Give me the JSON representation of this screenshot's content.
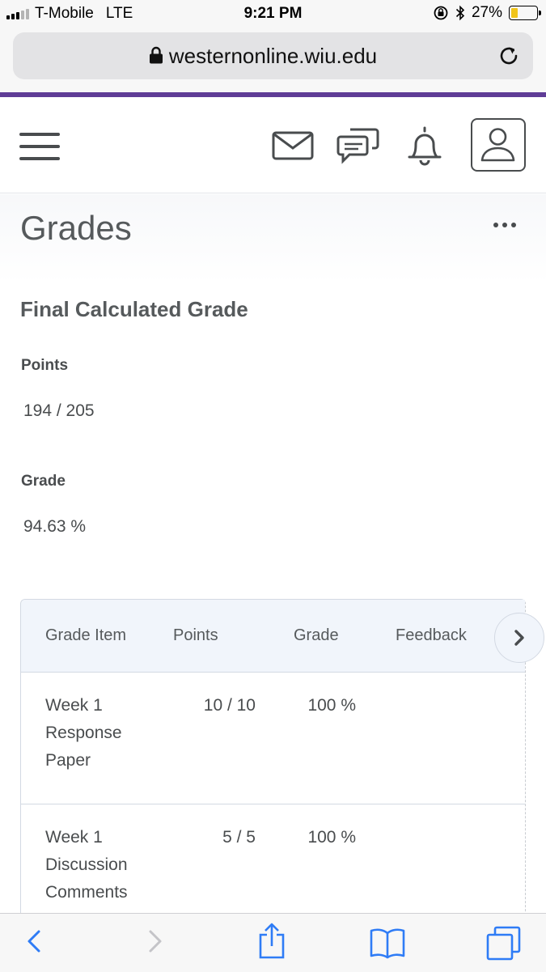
{
  "status_bar": {
    "carrier": "T-Mobile",
    "network": "LTE",
    "time": "9:21 PM",
    "battery_percent": "27%",
    "battery_level": 0.27,
    "signal_bars_on": 3,
    "signal_bars_total": 5
  },
  "browser": {
    "url": "westernonline.wiu.edu"
  },
  "colors": {
    "brand": "#5f3c96",
    "battery": "#f0c419",
    "ios_blue": "#2f7cf6",
    "text": "#494c4e"
  },
  "nav": {
    "icons": [
      "hamburger-menu-icon",
      "mail-icon",
      "chat-icon",
      "bell-icon",
      "user-avatar-icon"
    ]
  },
  "page": {
    "title": "Grades",
    "section_title": "Final Calculated Grade",
    "points_label": "Points",
    "points_value": "194 / 205",
    "grade_label": "Grade",
    "grade_value": "94.63 %"
  },
  "table": {
    "headers": [
      "Grade Item",
      "Points",
      "Grade",
      "Feedback"
    ],
    "rows": [
      {
        "item": "Week 1 Response Paper",
        "points": "10 / 10",
        "grade": "100 %"
      },
      {
        "item": "Week 1 Discussion Comments",
        "points": "5 / 5",
        "grade": "100 %"
      }
    ]
  },
  "toolbar": {
    "icons": [
      "back-icon",
      "forward-icon",
      "share-icon",
      "bookmarks-icon",
      "tabs-icon"
    ]
  }
}
